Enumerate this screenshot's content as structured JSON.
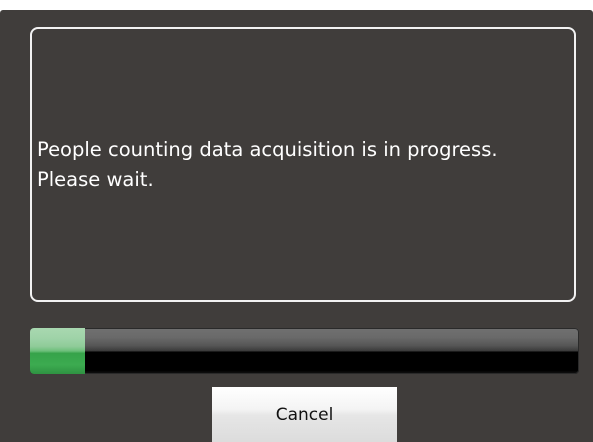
{
  "dialog": {
    "message_lines": [
      "People counting data acquisition is in progress.",
      "Please wait."
    ],
    "progress_fraction": 0.1,
    "cancel_label": "Cancel"
  },
  "colors": {
    "dialog_background": "#403d3b",
    "message_border": "#f2f2f2",
    "message_text": "#ffffff",
    "progress_track": "#000000",
    "progress_fill": "#3cab50"
  }
}
